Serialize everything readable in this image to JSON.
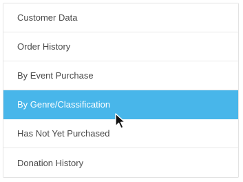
{
  "menu": {
    "items": [
      {
        "label": "Customer Data",
        "active": false
      },
      {
        "label": "Order History",
        "active": false
      },
      {
        "label": "By Event Purchase",
        "active": false
      },
      {
        "label": "By Genre/Classification",
        "active": true
      },
      {
        "label": "Has Not Yet Purchased",
        "active": false
      },
      {
        "label": "Donation History",
        "active": false
      }
    ]
  },
  "colors": {
    "active_background": "#48b6ea",
    "active_text": "#ffffff",
    "text": "#4a4a4a",
    "border": "#e3e3e3"
  },
  "cursor": {
    "icon": "arrow-cursor-icon"
  }
}
